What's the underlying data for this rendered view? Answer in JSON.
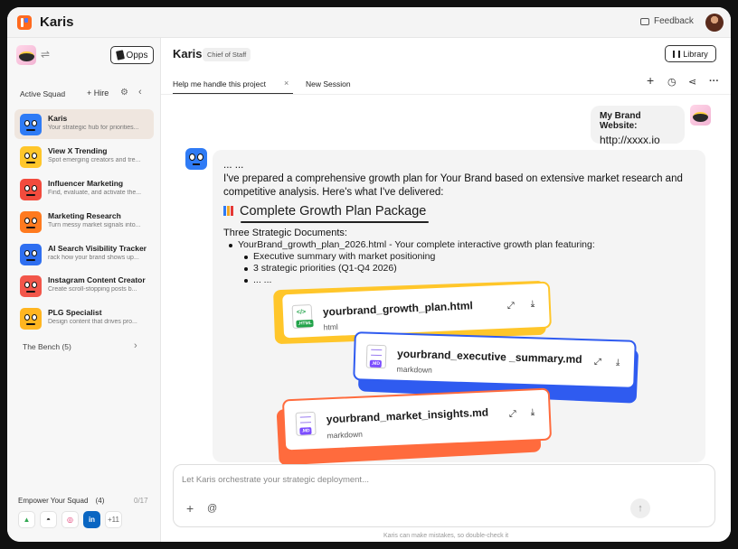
{
  "app": {
    "title": "Karis",
    "feedback": "Feedback"
  },
  "sidebar": {
    "opps_label": "Opps",
    "squad_title": "Active Squad",
    "hire_label": "+ Hire",
    "agents": [
      {
        "name": "Karis",
        "desc": "Your strategic hub for priorities...",
        "color": "#2f7bf5"
      },
      {
        "name": "View X Trending",
        "desc": "Spot emerging creators and tre...",
        "color": "#ffc62a"
      },
      {
        "name": "Influencer Marketing",
        "desc": "Find, evaluate, and activate the...",
        "color": "#f24b3d"
      },
      {
        "name": "Marketing Research",
        "desc": "Turn messy market signals into...",
        "color": "#ff7a1f"
      },
      {
        "name": "AI Search Visibility Tracker",
        "desc": "rack how your brand shows up...",
        "color": "#2f6ff0"
      },
      {
        "name": "Instagram Content Creator",
        "desc": "Create scroll-stopping posts b...",
        "color": "#f2564a"
      },
      {
        "name": "PLG Specialist",
        "desc": "Design content that drives pro...",
        "color": "#ffb520"
      }
    ],
    "bench_label": "The Bench (5)",
    "empower_label": "Empower Your Squad",
    "empower_count": "(4)",
    "empower_ratio": "0/17",
    "more_tools": "+11"
  },
  "main": {
    "chat_title": "Karis",
    "role_badge": "Chief of Staff",
    "library_label": "Library",
    "tabs": [
      "Help me handle this project",
      "New Session"
    ],
    "user_message": {
      "line1": "My Brand Website:",
      "line2": "http://xxxx.io"
    },
    "bot": {
      "ellipsis": "... ...",
      "intro1": "I've prepared a comprehensive growth plan for Your Brand based on extensive market research and",
      "intro2": "competitive analysis. Here's what I've delivered:",
      "package_title": "Complete Growth Plan Package",
      "docs_heading": "Three Strategic Documents:",
      "bullet1": "YourBrand_growth_plan_2026.html - Your complete interactive growth plan featuring:",
      "sub1": "Executive summary with market positioning",
      "sub2": "3 strategic priorities (Q1-Q4 2026)",
      "sub3": "... ..."
    },
    "files": [
      {
        "name": "yourbrand_growth_plan.html",
        "type": "html",
        "tag": ".HTML",
        "color": "#ffc62a"
      },
      {
        "name": "yourbrand_executive _summary.md",
        "type": "markdown",
        "tag": ".MD",
        "color": "#2f5bf0"
      },
      {
        "name": "yourbrand_market_insights.md",
        "type": "markdown",
        "tag": ".MD",
        "color": "#ff6b3d"
      }
    ],
    "composer_placeholder": "Let Karis orchestrate your strategic deployment...",
    "disclaimer": "Karis can make mistakes, so double-check it"
  }
}
